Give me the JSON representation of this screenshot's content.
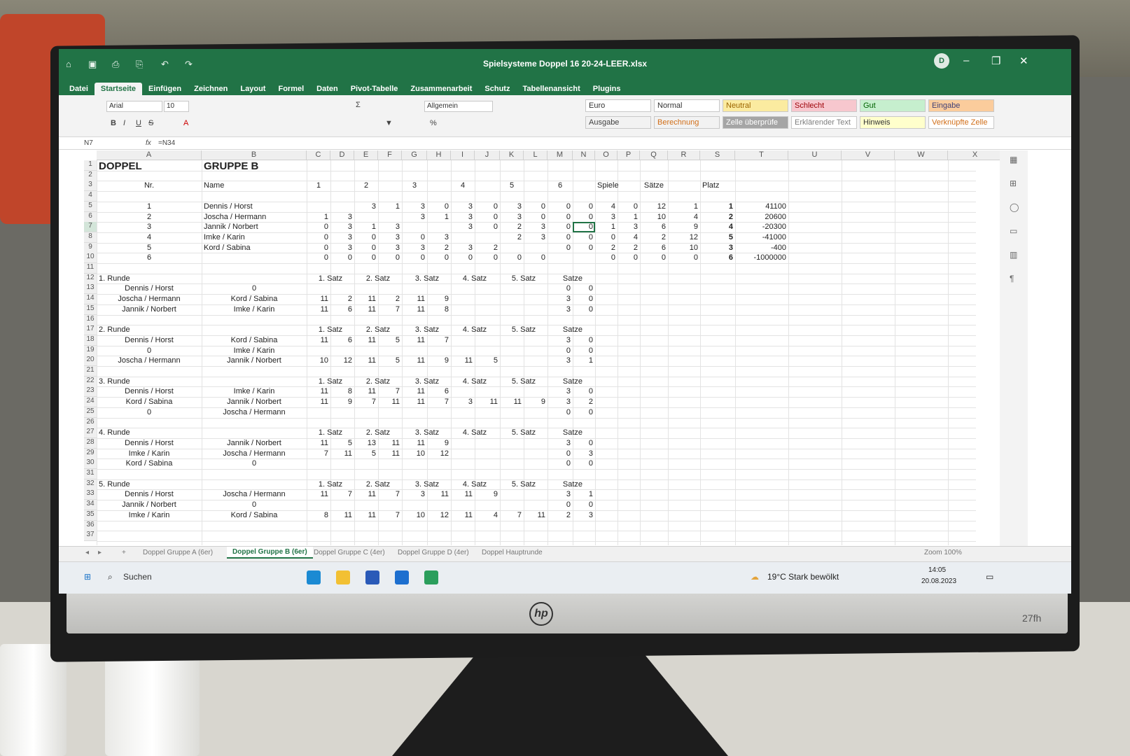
{
  "window": {
    "title": "Spielsysteme Doppel 16 20-24-LEER.xlsx",
    "avatar": "D"
  },
  "ribbon_tabs": [
    "Datei",
    "Startseite",
    "Einfügen",
    "Zeichnen",
    "Layout",
    "Formel",
    "Daten",
    "Pivot-Tabelle",
    "Zusammenarbeit",
    "Schutz",
    "Tabellenansicht",
    "Plugins"
  ],
  "font": {
    "name": "Arial",
    "size": "10"
  },
  "number_format": "Allgemein",
  "styles": [
    {
      "label": "Euro",
      "bg": "#ffffff",
      "fg": "#333333"
    },
    {
      "label": "Normal",
      "bg": "#ffffff",
      "fg": "#333333"
    },
    {
      "label": "Neutral",
      "bg": "#fbeba0",
      "fg": "#9c6500"
    },
    {
      "label": "Schlecht",
      "bg": "#f7c7ce",
      "fg": "#9c0006"
    },
    {
      "label": "Gut",
      "bg": "#c6efce",
      "fg": "#006100"
    },
    {
      "label": "Eingabe",
      "bg": "#fbcc9c",
      "fg": "#3f3f76"
    },
    {
      "label": "Ausgabe",
      "bg": "#f2f2f2",
      "fg": "#3f3f3f"
    },
    {
      "label": "Berechnung",
      "bg": "#f2f2f2",
      "fg": "#d16e18"
    },
    {
      "label": "Zelle überprüfe",
      "bg": "#a5a5a5",
      "fg": "#ffffff"
    },
    {
      "label": "Erklärender Text",
      "bg": "#ffffff",
      "fg": "#7f7f7f"
    },
    {
      "label": "Hinweis",
      "bg": "#ffffcc",
      "fg": "#333333"
    },
    {
      "label": "Verknüpfte Zelle",
      "bg": "#ffffff",
      "fg": "#d16e18"
    }
  ],
  "formula_bar": {
    "cell_ref": "N7",
    "fx": "fx",
    "formula": "=N34"
  },
  "columns": [
    "A",
    "B",
    "C",
    "D",
    "E",
    "F",
    "G",
    "H",
    "I",
    "J",
    "K",
    "L",
    "M",
    "N",
    "O",
    "P",
    "Q",
    "R",
    "S",
    "T",
    "U",
    "V",
    "W",
    "X"
  ],
  "rows": [
    "1",
    "2",
    "3",
    "4",
    "5",
    "6",
    "7",
    "8",
    "9",
    "10",
    "11",
    "12",
    "13",
    "14",
    "15",
    "16",
    "17",
    "18",
    "19",
    "20",
    "21",
    "22",
    "23",
    "24",
    "25",
    "26",
    "27",
    "28",
    "29",
    "30",
    "31",
    "32",
    "33",
    "34",
    "35",
    "36",
    "37"
  ],
  "sheet": {
    "r1": {
      "A": "DOPPEL",
      "B": "GRUPPE B"
    },
    "r3": {
      "A": "Nr.",
      "B": "Name",
      "C": "1",
      "E": "2",
      "G": "3",
      "I": "4",
      "K": "5",
      "M": "6",
      "O": "Spiele",
      "Q": "Sätze",
      "S": "Platz"
    },
    "table": [
      {
        "row": "5",
        "A": "1",
        "B": "Dennis / Horst",
        "v": [
          "",
          "",
          "3",
          "1",
          "3",
          "0",
          "3",
          "0",
          "3",
          "0",
          "0",
          "0",
          "4",
          "0",
          "12",
          "1",
          "1",
          "41100"
        ]
      },
      {
        "row": "6",
        "A": "2",
        "B": "Joscha / Hermann",
        "v": [
          "1",
          "3",
          "",
          "",
          "3",
          "1",
          "3",
          "0",
          "3",
          "0",
          "0",
          "0",
          "3",
          "1",
          "10",
          "4",
          "2",
          "20600"
        ]
      },
      {
        "row": "7",
        "A": "3",
        "B": "Jannik / Norbert",
        "v": [
          "0",
          "3",
          "1",
          "3",
          "",
          "",
          "3",
          "0",
          "2",
          "3",
          "0",
          "0",
          "1",
          "3",
          "6",
          "9",
          "4",
          "-20300"
        ]
      },
      {
        "row": "8",
        "A": "4",
        "B": "Imke / Karin",
        "v": [
          "0",
          "3",
          "0",
          "3",
          "0",
          "3",
          "",
          "",
          "2",
          "3",
          "0",
          "0",
          "0",
          "4",
          "2",
          "12",
          "5",
          "-41000"
        ]
      },
      {
        "row": "9",
        "A": "5",
        "B": "Kord / Sabina",
        "v": [
          "0",
          "3",
          "0",
          "3",
          "3",
          "2",
          "3",
          "2",
          "",
          "",
          "0",
          "0",
          "2",
          "2",
          "6",
          "10",
          "3",
          "-400"
        ]
      },
      {
        "row": "10",
        "A": "6",
        "B": "",
        "v": [
          "0",
          "0",
          "0",
          "0",
          "0",
          "0",
          "0",
          "0",
          "0",
          "0",
          "",
          "",
          "0",
          "0",
          "0",
          "0",
          "6",
          "-1000000"
        ]
      }
    ],
    "set_headers": [
      "1. Satz",
      "2. Satz",
      "3. Satz",
      "4. Satz",
      "5. Satz",
      "Satze"
    ],
    "rounds": [
      {
        "title": "1. Runde",
        "hrow": "12",
        "matches": [
          {
            "row": "13",
            "a": "Dennis / Horst",
            "b": "0",
            "s": [],
            "r": [
              "0",
              "0"
            ]
          },
          {
            "row": "14",
            "a": "Joscha / Hermann",
            "b": "Kord / Sabina",
            "s": [
              "11",
              "2",
              "11",
              "2",
              "11",
              "9"
            ],
            "r": [
              "3",
              "0"
            ]
          },
          {
            "row": "15",
            "a": "Jannik / Norbert",
            "b": "Imke / Karin",
            "s": [
              "11",
              "6",
              "11",
              "7",
              "11",
              "8"
            ],
            "r": [
              "3",
              "0"
            ]
          }
        ]
      },
      {
        "title": "2. Runde",
        "hrow": "17",
        "matches": [
          {
            "row": "18",
            "a": "Dennis / Horst",
            "b": "Kord / Sabina",
            "s": [
              "11",
              "6",
              "11",
              "5",
              "11",
              "7"
            ],
            "r": [
              "3",
              "0"
            ]
          },
          {
            "row": "19",
            "a": "0",
            "b": "Imke / Karin",
            "s": [],
            "r": [
              "0",
              "0"
            ]
          },
          {
            "row": "20",
            "a": "Joscha / Hermann",
            "b": "Jannik / Norbert",
            "s": [
              "10",
              "12",
              "11",
              "5",
              "11",
              "9",
              "11",
              "5"
            ],
            "r": [
              "3",
              "1"
            ]
          }
        ]
      },
      {
        "title": "3. Runde",
        "hrow": "22",
        "matches": [
          {
            "row": "23",
            "a": "Dennis / Horst",
            "b": "Imke / Karin",
            "s": [
              "11",
              "8",
              "11",
              "7",
              "11",
              "6"
            ],
            "r": [
              "3",
              "0"
            ]
          },
          {
            "row": "24",
            "a": "Kord / Sabina",
            "b": "Jannik / Norbert",
            "s": [
              "11",
              "9",
              "7",
              "11",
              "11",
              "7",
              "3",
              "11",
              "11",
              "9"
            ],
            "r": [
              "3",
              "2"
            ]
          },
          {
            "row": "25",
            "a": "0",
            "b": "Joscha / Hermann",
            "s": [],
            "r": [
              "0",
              "0"
            ]
          }
        ]
      },
      {
        "title": "4. Runde",
        "hrow": "27",
        "matches": [
          {
            "row": "28",
            "a": "Dennis / Horst",
            "b": "Jannik / Norbert",
            "s": [
              "11",
              "5",
              "13",
              "11",
              "11",
              "9"
            ],
            "r": [
              "3",
              "0"
            ]
          },
          {
            "row": "29",
            "a": "Imke / Karin",
            "b": "Joscha / Hermann",
            "s": [
              "7",
              "11",
              "5",
              "11",
              "10",
              "12"
            ],
            "r": [
              "0",
              "3"
            ]
          },
          {
            "row": "30",
            "a": "Kord / Sabina",
            "b": "0",
            "s": [],
            "r": [
              "0",
              "0"
            ]
          }
        ]
      },
      {
        "title": "5. Runde",
        "hrow": "32",
        "matches": [
          {
            "row": "33",
            "a": "Dennis / Horst",
            "b": "Joscha / Hermann",
            "s": [
              "11",
              "7",
              "11",
              "7",
              "3",
              "11",
              "11",
              "9"
            ],
            "r": [
              "3",
              "1"
            ]
          },
          {
            "row": "34",
            "a": "Jannik / Norbert",
            "b": "0",
            "s": [],
            "r": [
              "0",
              "0"
            ]
          },
          {
            "row": "35",
            "a": "Imke / Karin",
            "b": "Kord / Sabina",
            "s": [
              "8",
              "11",
              "11",
              "7",
              "10",
              "12",
              "11",
              "4",
              "7",
              "11"
            ],
            "r": [
              "2",
              "3"
            ]
          }
        ]
      }
    ]
  },
  "sheet_tabs": [
    "Doppel Gruppe A (6er)",
    "Doppel Gruppe B (6er)",
    "Doppel Gruppe C (4er)",
    "Doppel Gruppe D (4er)",
    "Doppel Hauptrunde"
  ],
  "active_sheet": "Doppel Gruppe B (6er)",
  "zoom": "Zoom 100%",
  "taskbar": {
    "search": "Suchen",
    "weather": "19°C  Stark bewölkt",
    "time": "14:05",
    "date": "20.08.2023"
  },
  "monitor": {
    "model": "27fh"
  }
}
